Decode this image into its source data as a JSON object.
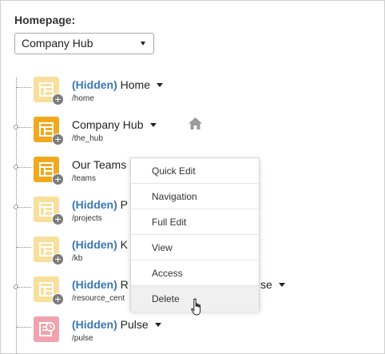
{
  "homepage": {
    "label": "Homepage:",
    "selected": "Company Hub"
  },
  "pages": [
    {
      "hidden_tag": "(Hidden)",
      "name": "Home",
      "path": "/home",
      "icon": "page-layout-icon",
      "tile": "light"
    },
    {
      "hidden_tag": "",
      "name": "Company Hub",
      "path": "/the_hub",
      "icon": "page-layout-icon",
      "tile": "dark",
      "is_homepage": true
    },
    {
      "hidden_tag": "",
      "name": "Our Teams",
      "path": "/teams",
      "icon": "page-layout-icon",
      "tile": "dark"
    },
    {
      "hidden_tag": "(Hidden)",
      "name": "P",
      "path": "/projects",
      "icon": "page-layout-icon",
      "tile": "light"
    },
    {
      "hidden_tag": "(Hidden)",
      "name": "K",
      "path": "/kb",
      "icon": "page-layout-icon",
      "tile": "light"
    },
    {
      "hidden_tag": "(Hidden)",
      "name": "R",
      "name_tail": "se",
      "path": "/resource_cent",
      "icon": "page-layout-icon",
      "tile": "light"
    },
    {
      "hidden_tag": "(Hidden)",
      "name": "Pulse",
      "path": "/pulse",
      "icon": "pulse-page-icon",
      "tile": "pink"
    }
  ],
  "context_menu": {
    "items": [
      "Quick Edit",
      "Navigation",
      "Full Edit",
      "View",
      "Access",
      "Delete"
    ],
    "hovered": "Delete"
  },
  "colors": {
    "hidden_tag": "#3a77b5",
    "tile_light": "#f9df9c",
    "tile_dark": "#f0a81d",
    "tile_pink": "#f0a2ad"
  }
}
